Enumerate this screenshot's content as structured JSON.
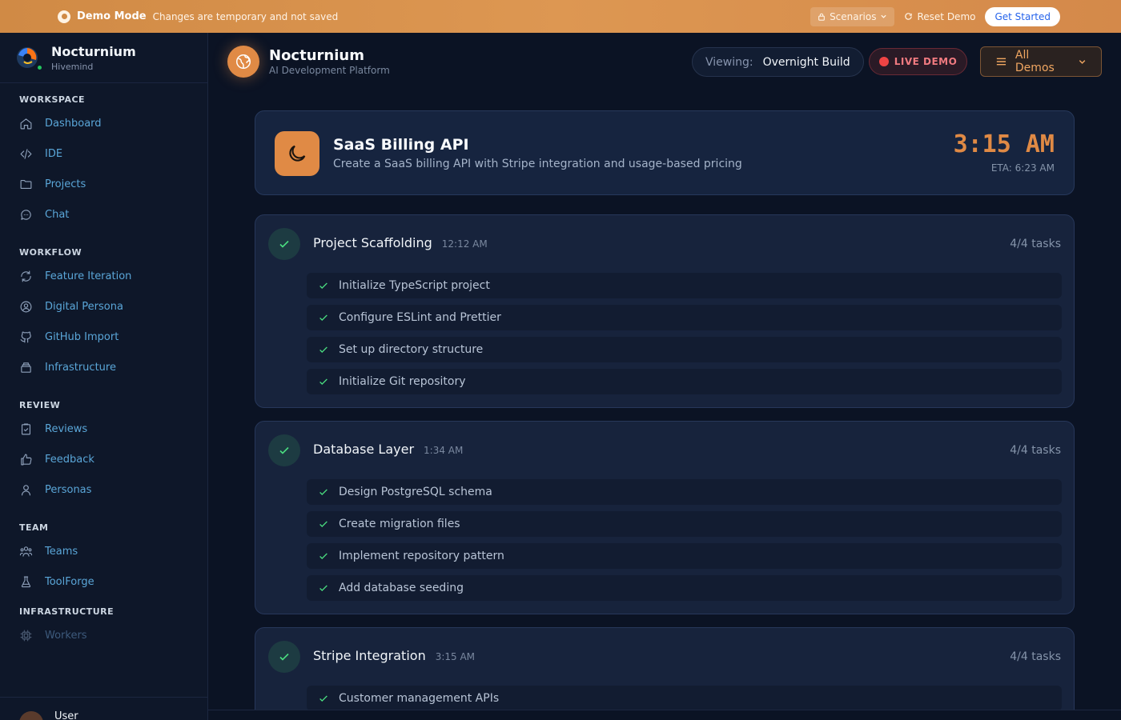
{
  "banner": {
    "mode": "Demo Mode",
    "message": "Changes are temporary and not saved",
    "scenarios": "Scenarios",
    "reset": "Reset Demo",
    "get_started": "Get Started"
  },
  "brand": {
    "name": "Nocturnium",
    "sub": "Hivemind"
  },
  "sidebar": {
    "workspace": {
      "title": "WORKSPACE",
      "items": [
        "Dashboard",
        "IDE",
        "Projects",
        "Chat"
      ]
    },
    "workflow": {
      "title": "WORKFLOW",
      "items": [
        "Feature Iteration",
        "Digital Persona",
        "GitHub Import",
        "Infrastructure"
      ]
    },
    "review": {
      "title": "REVIEW",
      "items": [
        "Reviews",
        "Feedback",
        "Personas"
      ]
    },
    "team": {
      "title": "TEAM",
      "items": [
        "Teams",
        "ToolForge"
      ]
    },
    "infrastructure": {
      "title": "INFRASTRUCTURE",
      "items": [
        "Workers"
      ]
    },
    "user": "User"
  },
  "header": {
    "title": "Nocturnium",
    "subtitle": "AI Development Platform",
    "viewing_label": "Viewing:",
    "viewing_value": "Overnight Build",
    "live": "LIVE DEMO",
    "all_demos": "All Demos"
  },
  "hero": {
    "title": "SaaS Billing API",
    "description": "Create a SaaS billing API with Stripe integration and usage-based pricing",
    "time": "3:15 AM",
    "eta": "ETA: 6:23 AM"
  },
  "phases": [
    {
      "title": "Project Scaffolding",
      "time": "12:12 AM",
      "count": "4/4 tasks",
      "tasks": [
        "Initialize TypeScript project",
        "Configure ESLint and Prettier",
        "Set up directory structure",
        "Initialize Git repository"
      ]
    },
    {
      "title": "Database Layer",
      "time": "1:34 AM",
      "count": "4/4 tasks",
      "tasks": [
        "Design PostgreSQL schema",
        "Create migration files",
        "Implement repository pattern",
        "Add database seeding"
      ]
    },
    {
      "title": "Stripe Integration",
      "time": "3:15 AM",
      "count": "4/4 tasks",
      "tasks": [
        "Customer management APIs"
      ]
    }
  ],
  "colors": {
    "accent": "#e08a45",
    "success": "#4ade80",
    "live": "#ef4444",
    "link": "#5aa6d8"
  }
}
